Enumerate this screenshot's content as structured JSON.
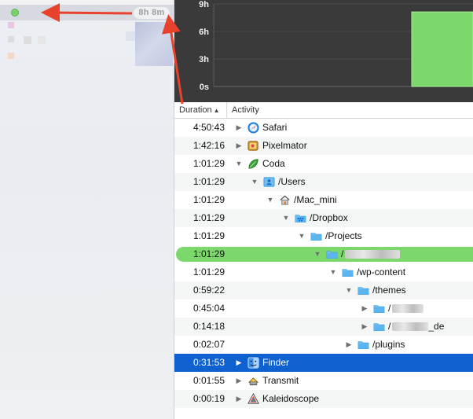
{
  "session": {
    "total_time": "8h 8m"
  },
  "chart": {
    "y_ticks": [
      "9h",
      "6h",
      "3h",
      "0s"
    ],
    "bar_color": "#7cd86a",
    "background": "#3a3a3a"
  },
  "chart_data": {
    "type": "bar",
    "categories": [
      ""
    ],
    "values": [
      8.13
    ],
    "ylim": [
      0,
      9
    ],
    "grid": true
  },
  "table": {
    "columns": {
      "duration": "Duration",
      "activity": "Activity"
    },
    "rows": [
      {
        "duration": "4:50:43",
        "label": "Safari",
        "depth": 0,
        "expanded": false,
        "icon": "safari-icon"
      },
      {
        "duration": "1:42:16",
        "label": "Pixelmator",
        "depth": 0,
        "expanded": false,
        "icon": "pixelmator-icon"
      },
      {
        "duration": "1:01:29",
        "label": "Coda",
        "depth": 0,
        "expanded": true,
        "icon": "coda-leaf-icon"
      },
      {
        "duration": "1:01:29",
        "label": "/Users",
        "depth": 1,
        "expanded": true,
        "icon": "users-folder-icon"
      },
      {
        "duration": "1:01:29",
        "label": "/Mac_mini",
        "depth": 2,
        "expanded": true,
        "icon": "home-icon"
      },
      {
        "duration": "1:01:29",
        "label": "/Dropbox",
        "depth": 3,
        "expanded": true,
        "icon": "dropbox-folder-icon"
      },
      {
        "duration": "1:01:29",
        "label": "/Projects",
        "depth": 4,
        "expanded": true,
        "icon": "folder-icon"
      },
      {
        "duration": "1:01:29",
        "label": "/",
        "depth": 5,
        "expanded": true,
        "icon": "folder-icon",
        "redacted": true
      },
      {
        "duration": "1:01:29",
        "label": "/wp-content",
        "depth": 6,
        "expanded": true,
        "icon": "folder-icon"
      },
      {
        "duration": "0:59:22",
        "label": "/themes",
        "depth": 7,
        "expanded": true,
        "icon": "folder-icon"
      },
      {
        "duration": "0:45:04",
        "label": "/",
        "depth": 8,
        "expanded": false,
        "icon": "folder-icon",
        "redacted": true
      },
      {
        "duration": "0:14:18",
        "label": "/",
        "suffix": "_de",
        "depth": 8,
        "expanded": false,
        "icon": "folder-icon",
        "redacted": true
      },
      {
        "duration": "0:02:07",
        "label": "/plugins",
        "depth": 7,
        "expanded": false,
        "icon": "folder-icon"
      },
      {
        "duration": "0:31:53",
        "label": "Finder",
        "depth": 0,
        "expanded": false,
        "icon": "finder-icon"
      },
      {
        "duration": "0:01:55",
        "label": "Transmit",
        "depth": 0,
        "expanded": false,
        "icon": "transmit-icon"
      },
      {
        "duration": "0:00:19",
        "label": "Kaleidoscope",
        "depth": 0,
        "expanded": false,
        "icon": "kaleidoscope-icon"
      }
    ]
  },
  "colors": {
    "selection": "#0f61d0",
    "highlight": "#7cd86a",
    "folder": "#5bb6f0",
    "annotation_arrow": "#e8412c"
  }
}
